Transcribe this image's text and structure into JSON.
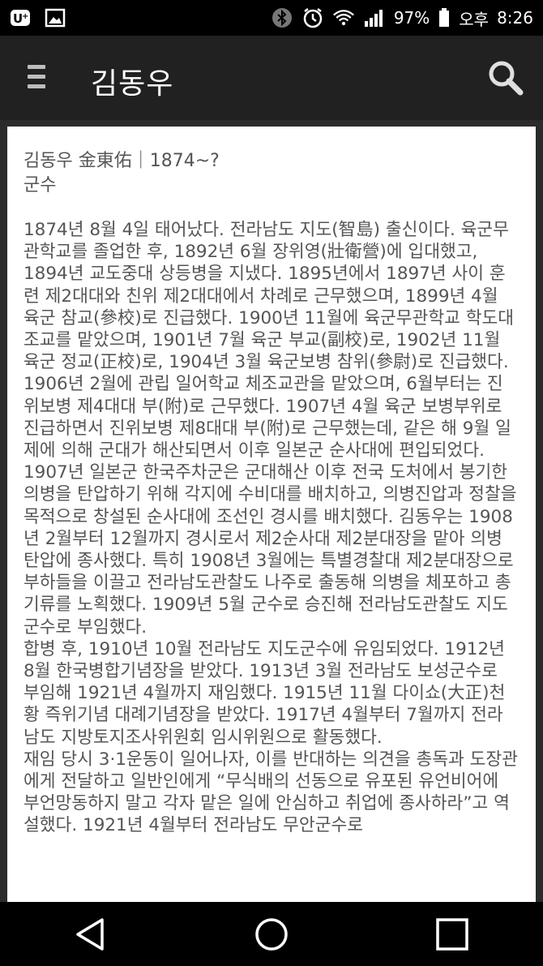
{
  "status_bar": {
    "battery_percent": "97%",
    "time_period": "오후",
    "time": "8:26",
    "icons": [
      "u-plus-icon",
      "gallery-icon",
      "bluetooth-icon",
      "alarm-icon",
      "wifi-icon",
      "signal-icon",
      "battery-icon"
    ]
  },
  "app_bar": {
    "title": "김동우",
    "menu_icon": "menu-icon",
    "search_icon": "search-icon"
  },
  "article": {
    "header": "김동우 金東佑｜1874~?",
    "role": "군수",
    "paragraphs": [
      "1874년 8월 4일 태어났다. 전라남도 지도(智島) 출신이다. 육군무관학교를 졸업한 후, 1892년 6월 장위영(壯衛營)에 입대했고, 1894년 교도중대 상등병을 지냈다. 1895년에서 1897년 사이 훈련 제2대대와 친위 제2대대에서 차례로 근무했으며, 1899년 4월 육군 참교(參校)로 진급했다. 1900년 11월에 육군무관학교 학도대 조교를 맡았으며, 1901년 7월 육군 부교(副校)로, 1902년 11월 육군 정교(正校)로, 1904년 3월 육군보병 참위(參尉)로 진급했다. 1906년 2월에 관립 일어학교 체조교관을 맡았으며, 6월부터는 진위보병 제4대대 부(附)로 근무했다. 1907년 4월 육군 보병부위로 진급하면서 진위보병 제8대대 부(附)로 근무했는데, 같은 해 9월 일제에 의해 군대가 해산되면서 이후 일본군 순사대에 편입되었다. 1907년 일본군 한국주차군은 군대해산 이후 전국 도처에서 봉기한 의병을 탄압하기 위해 각지에 수비대를 배치하고, 의병진압과 정찰을 목적으로 창설된 순사대에 조선인 경시를 배치했다. 김동우는 1908년 2월부터 12월까지 경시로서 제2순사대 제2분대장을 맡아 의병탄압에 종사했다. 특히 1908년 3월에는 특별경찰대 제2분대장으로 부하들을 이끌고 전라남도관찰도 나주로 출동해 의병을 체포하고 총기류를 노획했다. 1909년 5월 군수로 승진해 전라남도관찰도 지도군수로 부임했다.",
      "합병 후, 1910년 10월 전라남도 지도군수에 유임되었다. 1912년 8월 한국병합기념장을 받았다. 1913년 3월 전라남도 보성군수로 부임해 1921년 4월까지 재임했다. 1915년 11월 다이쇼(大正)천황 즉위기념 대례기념장을 받았다. 1917년 4월부터 7월까지 전라남도 지방토지조사위원회 임시위원으로 활동했다.",
      "재임 당시 3·1운동이 일어나자, 이를 반대하는 의견을 총독과 도장관에게 전달하고 일반인에게 “무식배의 선동으로 유포된 유언비어에 부언망동하지 말고 각자 맡은 일에 안심하고 취업에 종사하라”고 역설했다. 1921년 4월부터 전라남도 무안군수로"
    ]
  },
  "nav_bar": {
    "buttons": [
      "back-icon",
      "home-icon",
      "recents-icon"
    ]
  },
  "colors": {
    "status_bar": "#000000",
    "app_bar": "#212121",
    "card": "#ffffff",
    "text": "#555555"
  }
}
